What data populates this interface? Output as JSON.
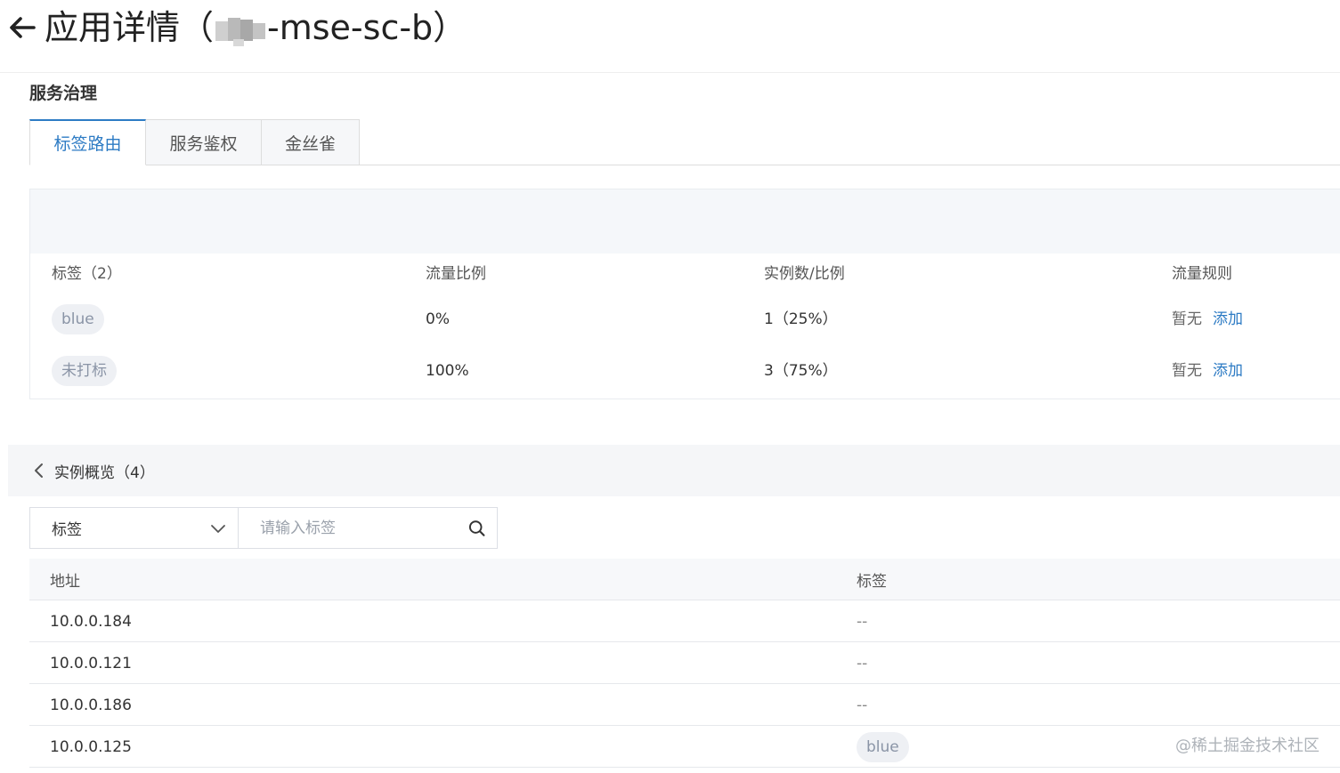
{
  "header": {
    "title_prefix": "应用详情",
    "open_paren": "（",
    "app_suffix": "-mse-sc-b",
    "close_paren": "）"
  },
  "section": {
    "title": "服务治理"
  },
  "tabs": [
    {
      "label": "标签路由",
      "active": true
    },
    {
      "label": "服务鉴权",
      "active": false
    },
    {
      "label": "金丝雀",
      "active": false
    }
  ],
  "route_table": {
    "headers": [
      "标签（2）",
      "流量比例",
      "实例数/比例",
      "流量规则"
    ],
    "rows": [
      {
        "tag": "blue",
        "traffic": "0%",
        "instances": "1（25%）",
        "rule_status": "暂无",
        "rule_action": "添加"
      },
      {
        "tag": "未打标",
        "traffic": "100%",
        "instances": "3（75%）",
        "rule_status": "暂无",
        "rule_action": "添加"
      }
    ]
  },
  "overview": {
    "title": "实例概览（4）"
  },
  "filter": {
    "select_value": "标签",
    "search_placeholder": "请输入标签"
  },
  "instance_table": {
    "headers": [
      "地址",
      "标签"
    ],
    "rows": [
      {
        "address": "10.0.0.184",
        "tag": "--"
      },
      {
        "address": "10.0.0.121",
        "tag": "--"
      },
      {
        "address": "10.0.0.186",
        "tag": "--"
      },
      {
        "address": "10.0.0.125",
        "tag": "blue"
      }
    ]
  },
  "watermark": "@稀土掘金技术社区",
  "colors": {
    "accent": "#2d7bc4",
    "pill_bg": "#eef0f4",
    "pill_text": "#8a94a6"
  }
}
